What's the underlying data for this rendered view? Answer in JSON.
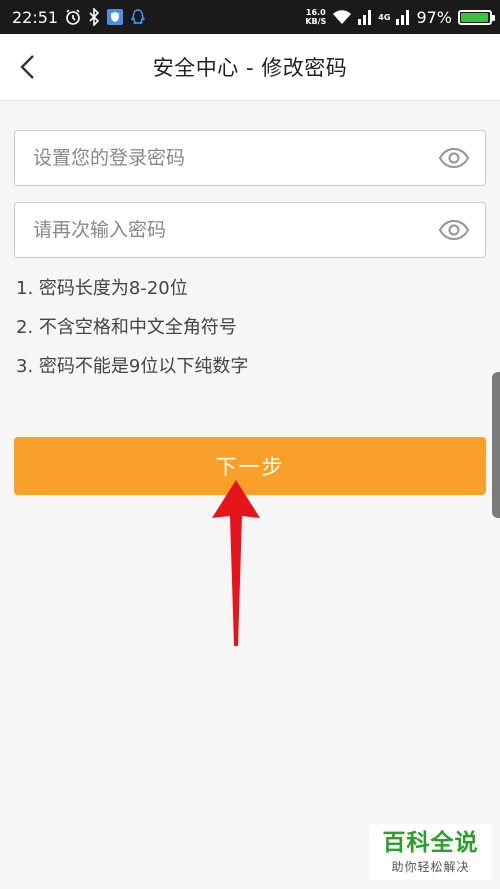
{
  "status_bar": {
    "time": "22:51",
    "net_speed_value": "16.0",
    "net_speed_unit": "KB/S",
    "network_badge": "4G",
    "battery_percent": "97%",
    "battery_level": 0.97,
    "icons": [
      "alarm-icon",
      "bluetooth-icon",
      "shield-app-icon",
      "qq-icon",
      "wifi-icon",
      "signal-icon",
      "battery-icon"
    ]
  },
  "header": {
    "title": "安全中心 - 修改密码",
    "back_icon": "chevron-left-icon"
  },
  "form": {
    "password_placeholder": "设置您的登录密码",
    "password_value": "",
    "confirm_placeholder": "请再次输入密码",
    "confirm_value": "",
    "eye_icon": "eye-icon"
  },
  "rules": [
    "1. 密码长度为8-20位",
    "2. 不含空格和中文全角符号",
    "3. 密码不能是9位以下纯数字"
  ],
  "next_button": {
    "label": "下一步"
  },
  "watermark": {
    "main": "百科全说",
    "sub": "助你轻松解决"
  },
  "colors": {
    "accent": "#f9a02b",
    "background": "#f6f6f6",
    "arrow": "#e8141c",
    "watermark_green": "#2aa02a",
    "status_bar": "#1a1a1a"
  }
}
